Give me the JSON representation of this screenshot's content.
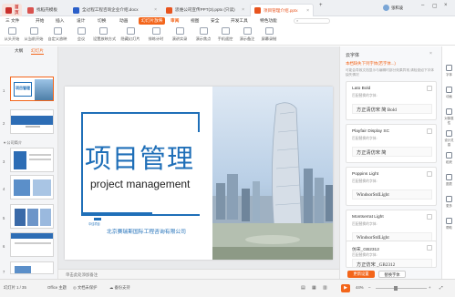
{
  "tabs": [
    {
      "label": "首页",
      "icon_color": "#c9302c",
      "active": false
    },
    {
      "label": "找稻壳模板",
      "icon_color": "#d9534f",
      "active": false
    },
    {
      "label": "全过程工程咨询企业介绍.docx",
      "icon_color": "#2b5fc9",
      "active": false
    },
    {
      "label": "思维公司宣传PPT(3).pptx (只读)",
      "icon_color": "#e8541e",
      "active": false
    },
    {
      "label": "项目管理介绍.pptx",
      "icon_color": "#e8541e",
      "active": true
    }
  ],
  "user_name": "张和凌",
  "menu": [
    "三 文件",
    "开始",
    "插入",
    "设计",
    "切换",
    "动画",
    "幻灯片放映",
    "审阅",
    "视图",
    "安全",
    "开发工具",
    "特色功能"
  ],
  "menu_selected": "幻灯片放映",
  "menu_current": "审阅",
  "toolbar": [
    "从头开始",
    "从当前开始",
    "自定义放映",
    "会议",
    "设置放映方式",
    "隐藏幻灯片",
    "排练计时",
    "演讲实录",
    "演示焦点",
    "手机遥控",
    "演示备注",
    "屏幕录制"
  ],
  "left_panel": {
    "tab_outline": "大纲",
    "tab_slides": "幻灯片",
    "section_label": "▾ 公司简介"
  },
  "slide": {
    "title": "项目管理",
    "subtitle": "project management",
    "company": "北京赛瑞斯国际工程咨询有限公司",
    "logo_text": "中佳项目"
  },
  "notes_placeholder": "单击此处添加备注",
  "right_panel": {
    "header": "云字体",
    "notice": "本档缺失下列字体(若字体...)",
    "notice_detail": "可能会导致文档显示与编辑时部分效果异常,请检查如下字体缺失情况",
    "fonts": [
      {
        "name": "Lato Bold",
        "sub": "匹配替换的字体:",
        "preview": "方正清仿宋 简 Bold"
      },
      {
        "name": "Playfair Display SC",
        "sub": "匹配替换的字体:",
        "preview": "方正清仿宋 简"
      },
      {
        "name": "Poppins Light",
        "sub": "匹配替换的字体:",
        "preview": "WindsorStdLight"
      },
      {
        "name": "Montserrat Light",
        "sub": "匹配替换的字体:",
        "preview": "WindsorStdLight"
      },
      {
        "name": "仿宋_GB2312",
        "sub": "匹配替换的字体:",
        "preview": "方正仿宋 _GB2312"
      }
    ],
    "btn_primary": "更新设置",
    "btn_secondary": "替换字体"
  },
  "side_tools": [
    "字体",
    "动画",
    "对象属性",
    "设计灵感",
    "稻壳",
    "图表",
    "更多",
    "帮助"
  ],
  "status": {
    "slide_counter": "幻灯片 1 / 35",
    "theme": "Office 主题",
    "doc_protect": "文档未保护",
    "backup": "备份支持",
    "zoom": "44%"
  },
  "colors": {
    "accent": "#f3651a",
    "slide_blue": "#1f6fb8"
  }
}
